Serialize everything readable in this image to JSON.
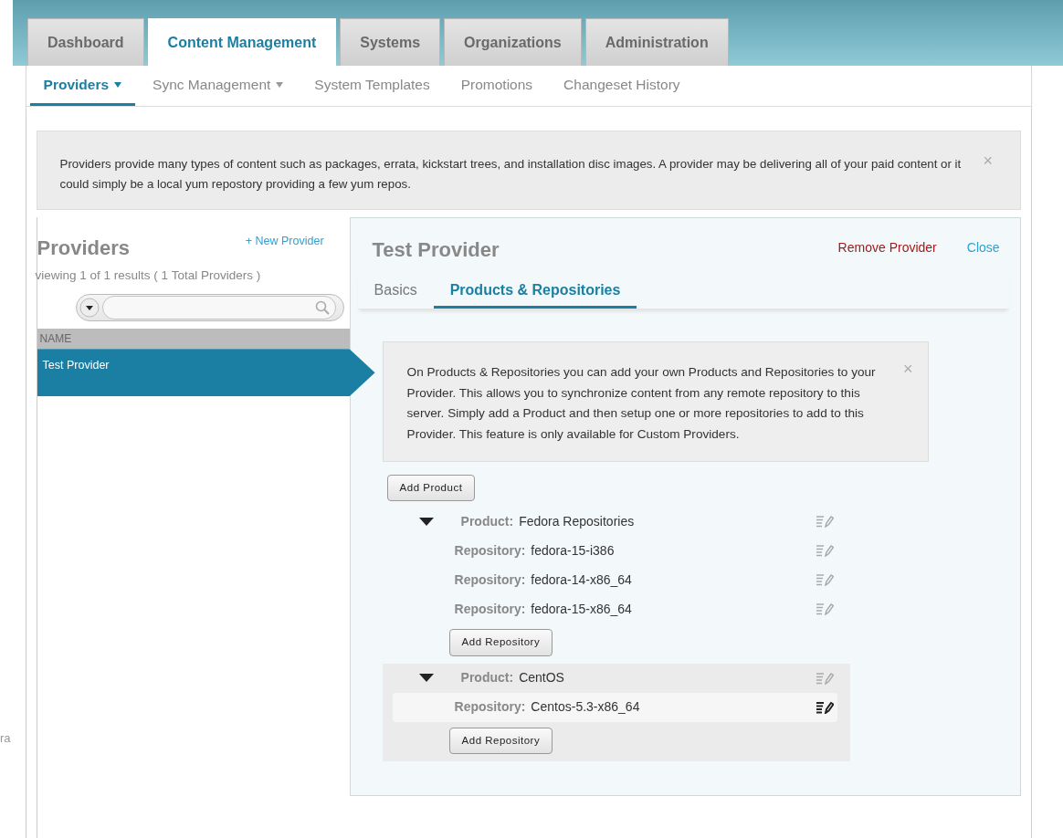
{
  "main_tabs": [
    {
      "label": "Dashboard",
      "selected": false
    },
    {
      "label": "Content Management",
      "selected": true
    },
    {
      "label": "Systems",
      "selected": false
    },
    {
      "label": "Organizations",
      "selected": false
    },
    {
      "label": "Administration",
      "selected": false
    }
  ],
  "sub_tabs": [
    {
      "label": "Providers",
      "has_menu": true,
      "selected": true
    },
    {
      "label": "Sync Management",
      "has_menu": true,
      "selected": false
    },
    {
      "label": "System Templates",
      "has_menu": false,
      "selected": false
    },
    {
      "label": "Promotions",
      "has_menu": false,
      "selected": false
    },
    {
      "label": "Changeset History",
      "has_menu": false,
      "selected": false
    }
  ],
  "info_message": {
    "text": "Providers provide many types of content such as packages, errata, kickstart trees, and installation disc images. A provider may be delivering all of your paid content or it could simply be a local yum repostory providing a few yum repos.",
    "close": "×"
  },
  "providers_panel": {
    "title": "Providers",
    "new_link": "+ New Provider",
    "summary": "viewing 1 of 1 results ( 1 Total Providers )",
    "column": "NAME",
    "rows": [
      {
        "name": "Test Provider",
        "selected": true
      }
    ]
  },
  "detail": {
    "title": "Test Provider",
    "remove_link": "Remove Provider",
    "close_link": "Close",
    "tabs": [
      {
        "label": "Basics",
        "selected": false
      },
      {
        "label": "Products & Repositories",
        "selected": true
      }
    ],
    "help": {
      "text": "On Products & Repositories you can add your own Products and Repositories to your Provider. This allows you to synchronize content from any remote repository to this server. Simply add a Product and then setup one or more repositories to add to this Provider. This feature is only available for Custom Providers.",
      "close": "×"
    },
    "add_product_button": "Add Product",
    "products": [
      {
        "label": "Product:",
        "name": "Fedora Repositories",
        "expanded": true,
        "highlighted": false,
        "repositories": [
          {
            "label": "Repository:",
            "name": "fedora-15-i386",
            "hovered": false
          },
          {
            "label": "Repository:",
            "name": "fedora-14-x86_64",
            "hovered": false
          },
          {
            "label": "Repository:",
            "name": "fedora-15-x86_64",
            "hovered": false
          }
        ],
        "add_repository_button": "Add Repository"
      },
      {
        "label": "Product:",
        "name": "CentOS",
        "expanded": true,
        "highlighted": true,
        "repositories": [
          {
            "label": "Repository:",
            "name": "Centos-5.3-x86_64",
            "hovered": true
          }
        ],
        "add_repository_button": "Add Repository"
      }
    ]
  },
  "edge_fragment": "ra"
}
